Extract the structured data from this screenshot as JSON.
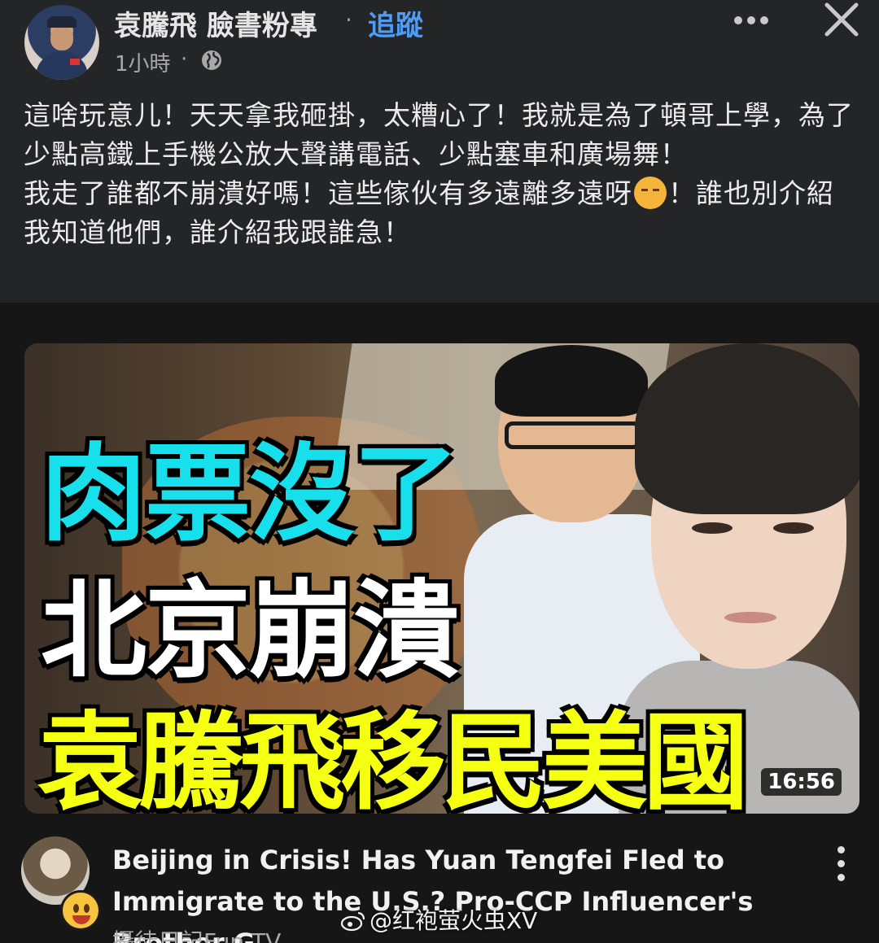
{
  "post": {
    "author": "袁騰飛 臉書粉專",
    "separator": "·",
    "follow_label": "追蹤",
    "time": "1小時",
    "time_separator": "·",
    "audience_icon": "globe-icon",
    "more_icon": "more-dots-icon",
    "close_icon": "close-icon",
    "text_line1": "這啥玩意儿！天天拿我砸掛，太糟心了！我就是為了頓哥上學，為了少點高鐵上手機公放大聲講電話、少點塞車和廣場舞！",
    "text_line2a": "我走了誰都不崩潰好嗎！這些傢伙有多遠離多遠呀",
    "text_line2_emoji": "sneezing-face-emoji",
    "text_line2b": "！誰也別介紹我知道他們，誰介紹我跟誰急！"
  },
  "video": {
    "thumbnail": {
      "headline_1": "肉票沒了",
      "headline_2": "北京崩潰",
      "headline_3": "袁騰飛移民美國",
      "duration": "16:56",
      "colors": {
        "headline_1": "#17e0ec",
        "headline_2": "#ffffff",
        "headline_3": "#f5ff12"
      }
    },
    "title": "Beijing in Crisis! Has Yuan Tengfei Fled to Immigrate to the U.S.? Pro-CCP Influencer's Brother G...",
    "channel": "攝徒日記Fun TV",
    "options_icon": "kebab-menu-icon"
  },
  "watermark": "@红袍萤火虫XV",
  "colors": {
    "background": "#1c1c1e",
    "card": "#242526",
    "link": "#4e9cf5",
    "text": "#ececec"
  }
}
